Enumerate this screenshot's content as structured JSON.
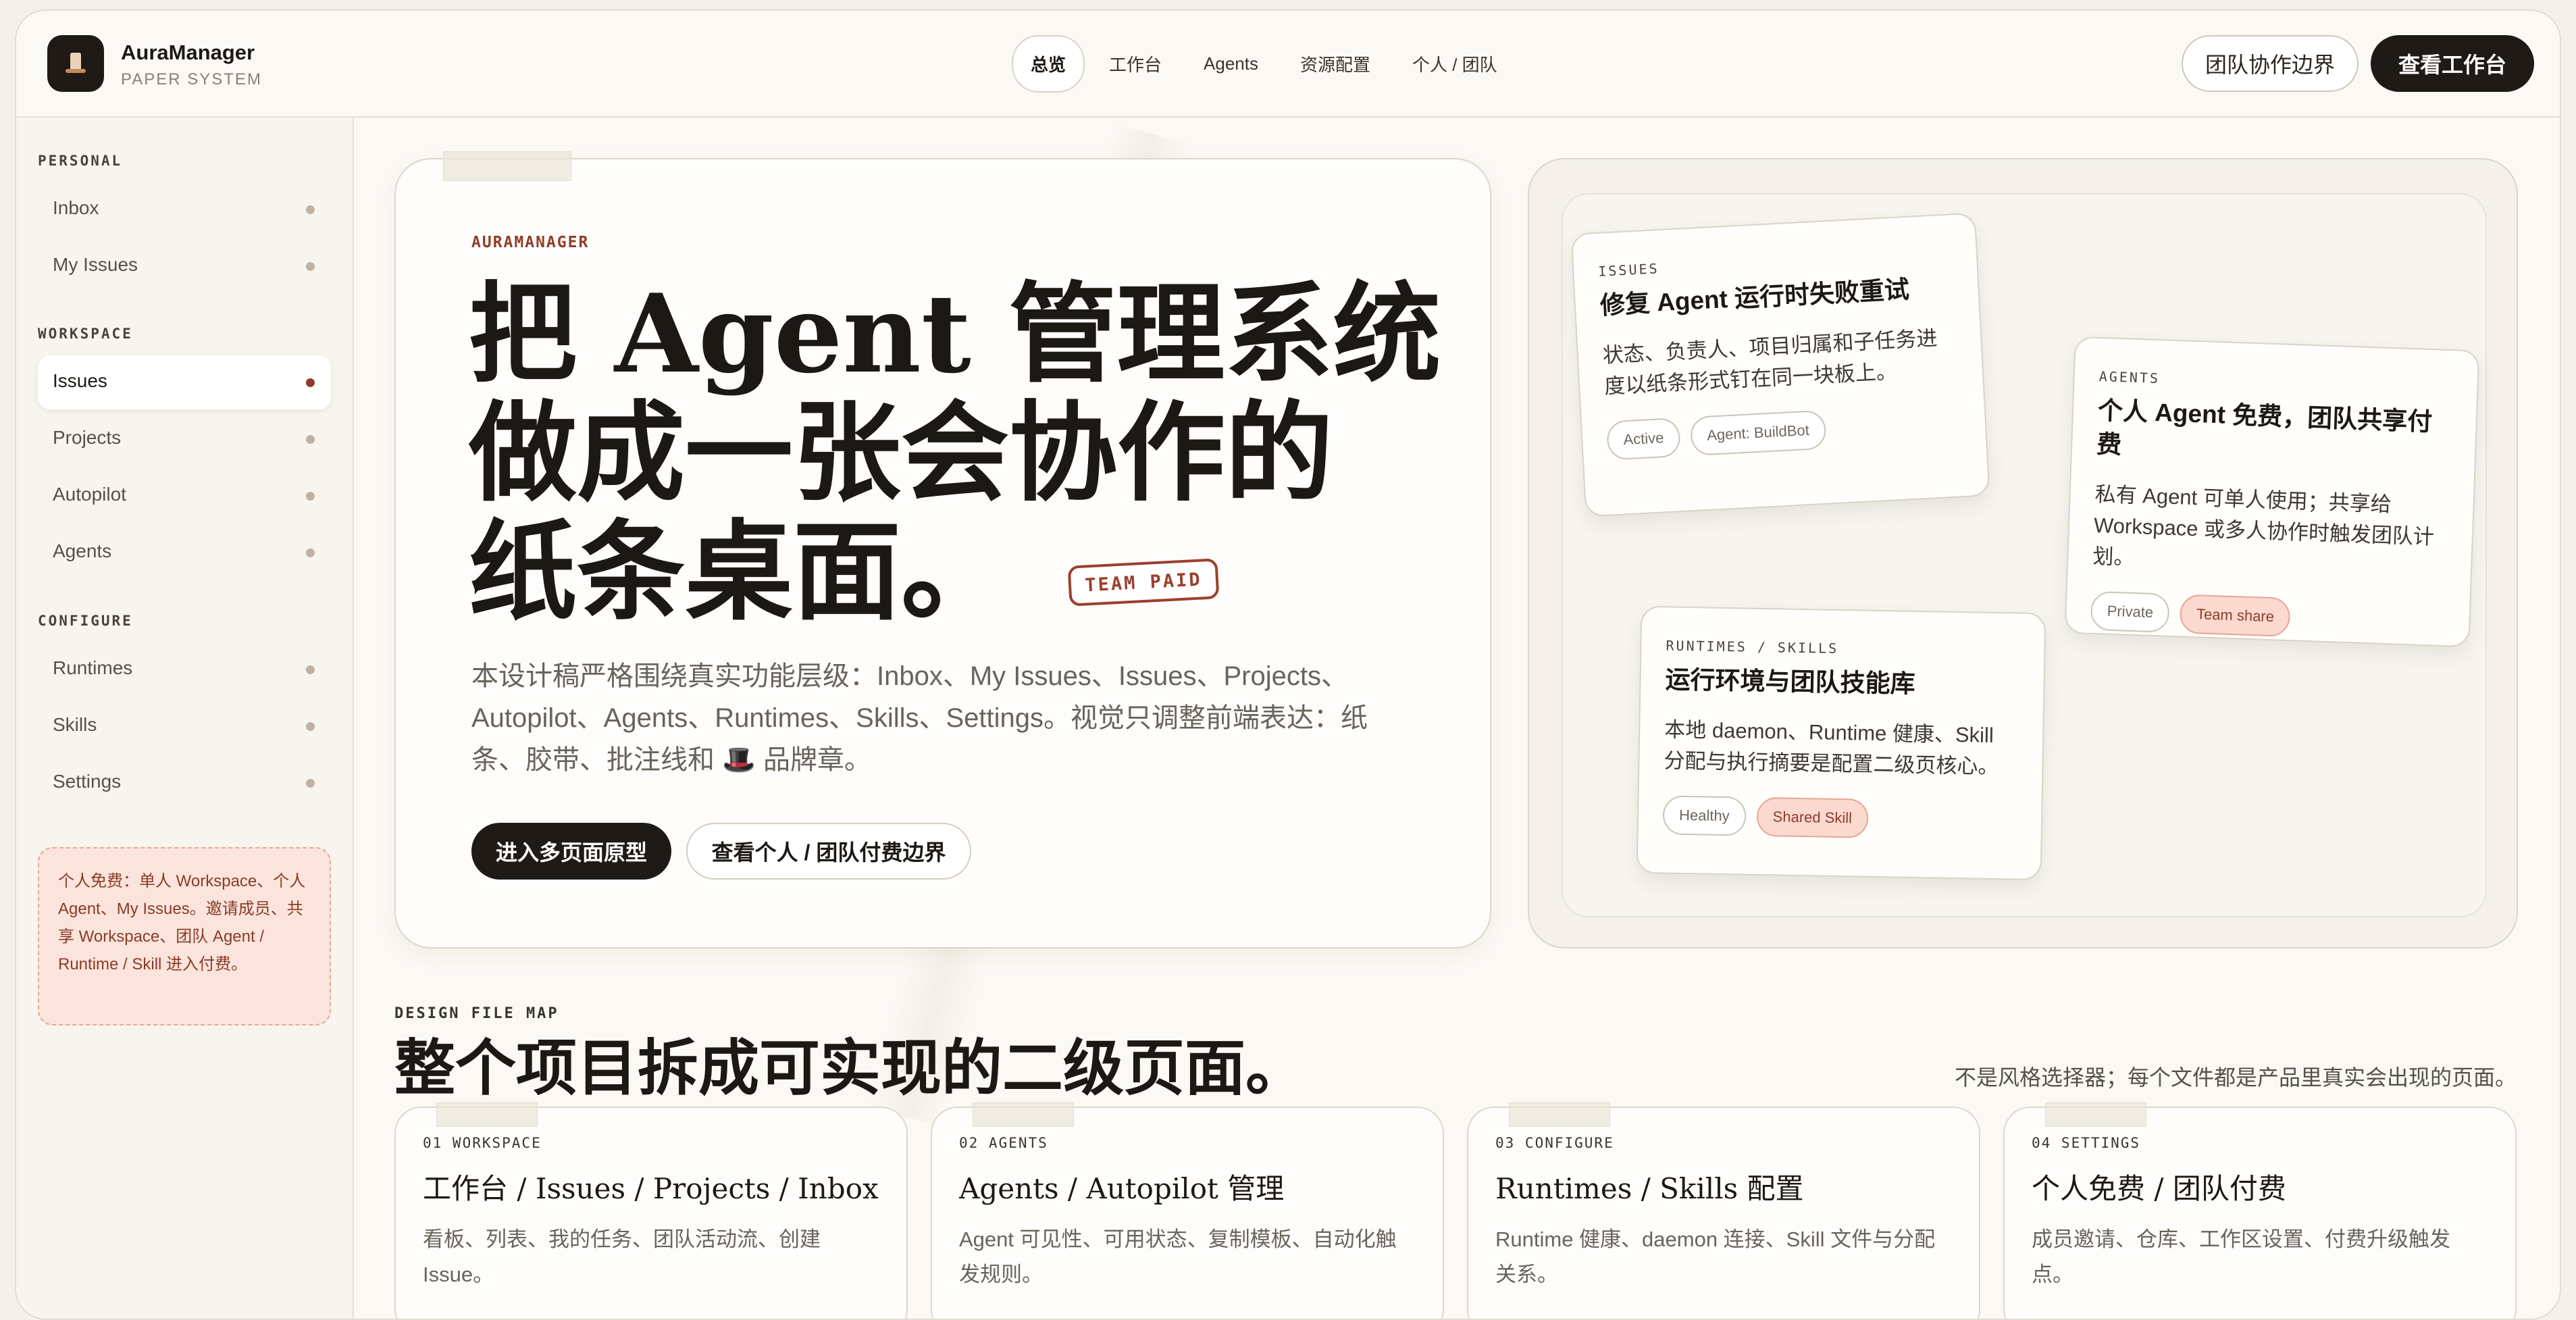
{
  "app": {
    "name": "AuraManager",
    "subtitle": "PAPER SYSTEM",
    "logo_icon": "top-hat-icon"
  },
  "nav": {
    "items": [
      {
        "label": "总览",
        "active": true
      },
      {
        "label": "工作台",
        "active": false
      },
      {
        "label": "Agents",
        "active": false
      },
      {
        "label": "资源配置",
        "active": false
      },
      {
        "label": "个人 / 团队",
        "active": false
      }
    ],
    "btn_outline": "团队协作边界",
    "btn_primary": "查看工作台"
  },
  "sidebar": {
    "sections": [
      {
        "title": "PERSONAL",
        "items": [
          "Inbox",
          "My Issues"
        ]
      },
      {
        "title": "WORKSPACE",
        "items": [
          "Issues",
          "Projects",
          "Autopilot",
          "Agents"
        ]
      },
      {
        "title": "CONFIGURE",
        "items": [
          "Runtimes",
          "Skills",
          "Settings"
        ]
      }
    ],
    "active_item": "Issues",
    "note": "个人免费：单人 Workspace、个人 Agent、My Issues。邀请成员、共享 Workspace、团队 Agent / Runtime / Skill 进入付费。"
  },
  "hero": {
    "eyebrow": "AURAMANAGER",
    "title_line1": "把 Agent 管理系统",
    "title_line2": "做成一张会协作的",
    "title_line3": "纸条桌面。",
    "stamp": "TEAM PAID",
    "description": "本设计稿严格围绕真实功能层级：Inbox、My Issues、Issues、Projects、Autopilot、Agents、Runtimes、Skills、Settings。视觉只调整前端表达：纸条、胶带、批注线和 🎩 品牌章。",
    "btn_primary": "进入多页面原型",
    "btn_secondary": "查看个人 / 团队付费边界"
  },
  "notes": [
    {
      "tag": "ISSUES",
      "title": "修复 Agent 运行时失败重试",
      "text": "状态、负责人、项目归属和子任务进度以纸条形式钉在同一块板上。",
      "chips": [
        "Active",
        "Agent: BuildBot"
      ]
    },
    {
      "tag": "AGENTS",
      "title": "个人 Agent 免费，团队共享付费",
      "text": "私有 Agent 可单人使用；共享给 Workspace 或多人协作时触发团队计划。",
      "chips": [
        "Private",
        "Team share"
      ]
    },
    {
      "tag": "RUNTIMES / SKILLS",
      "title": "运行环境与团队技能库",
      "text": "本地 daemon、Runtime 健康、Skill 分配与执行摘要是配置二级页核心。",
      "chips": [
        "Healthy",
        "Shared Skill"
      ]
    }
  ],
  "file_map": {
    "tag": "DESIGN FILE MAP",
    "title": "整个项目拆成可实现的二级页面。",
    "note": "不是风格选择器；每个文件都是产品里真实会出现的页面。",
    "cards": [
      {
        "tag": "01 WORKSPACE",
        "title": "工作台 / Issues / Projects / Inbox",
        "text": "看板、列表、我的任务、团队活动流、创建 Issue。"
      },
      {
        "tag": "02 AGENTS",
        "title": "Agents / Autopilot 管理",
        "text": "Agent 可见性、可用状态、复制模板、自动化触发规则。"
      },
      {
        "tag": "03 CONFIGURE",
        "title": "Runtimes / Skills 配置",
        "text": "Runtime 健康、daemon 连接、Skill 文件与分配关系。"
      },
      {
        "tag": "04 SETTINGS",
        "title": "个人免费 / 团队付费",
        "text": "成员邀请、仓库、工作区设置、付费升级触发点。"
      }
    ]
  },
  "colors": {
    "accent": "#8e3d2a",
    "dark": "#1f1a16",
    "paper": "#fbf9f4",
    "pink": "#fbd9cf"
  }
}
